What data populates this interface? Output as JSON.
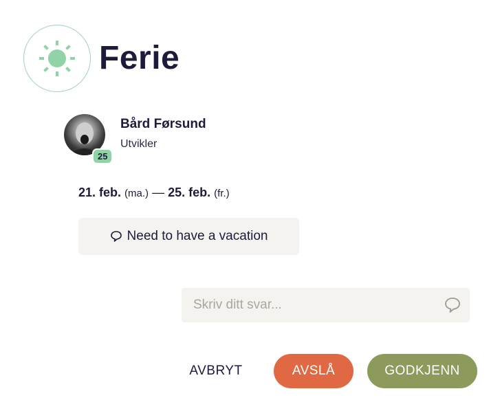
{
  "header": {
    "title": "Ferie",
    "icon": "sun-icon",
    "icon_color": "#8fd3a7"
  },
  "user": {
    "name": "Bård Førsund",
    "role": "Utvikler",
    "badge": "25",
    "avatar_icon": "avatar-photo"
  },
  "dates": {
    "start": "21. feb.",
    "start_day": "(ma.)",
    "separator": "—",
    "end": "25. feb.",
    "end_day": "(fr.)"
  },
  "comment": {
    "icon": "speech-bubble-icon",
    "text": "Need to have a vacation"
  },
  "reply": {
    "placeholder": "Skriv ditt svar...",
    "value": "",
    "icon": "speech-bubble-icon"
  },
  "actions": {
    "cancel_label": "AVBRYT",
    "reject_label": "AVSLÅ",
    "approve_label": "GODKJENN",
    "reject_color": "#e06843",
    "approve_color": "#8c9a5c"
  }
}
